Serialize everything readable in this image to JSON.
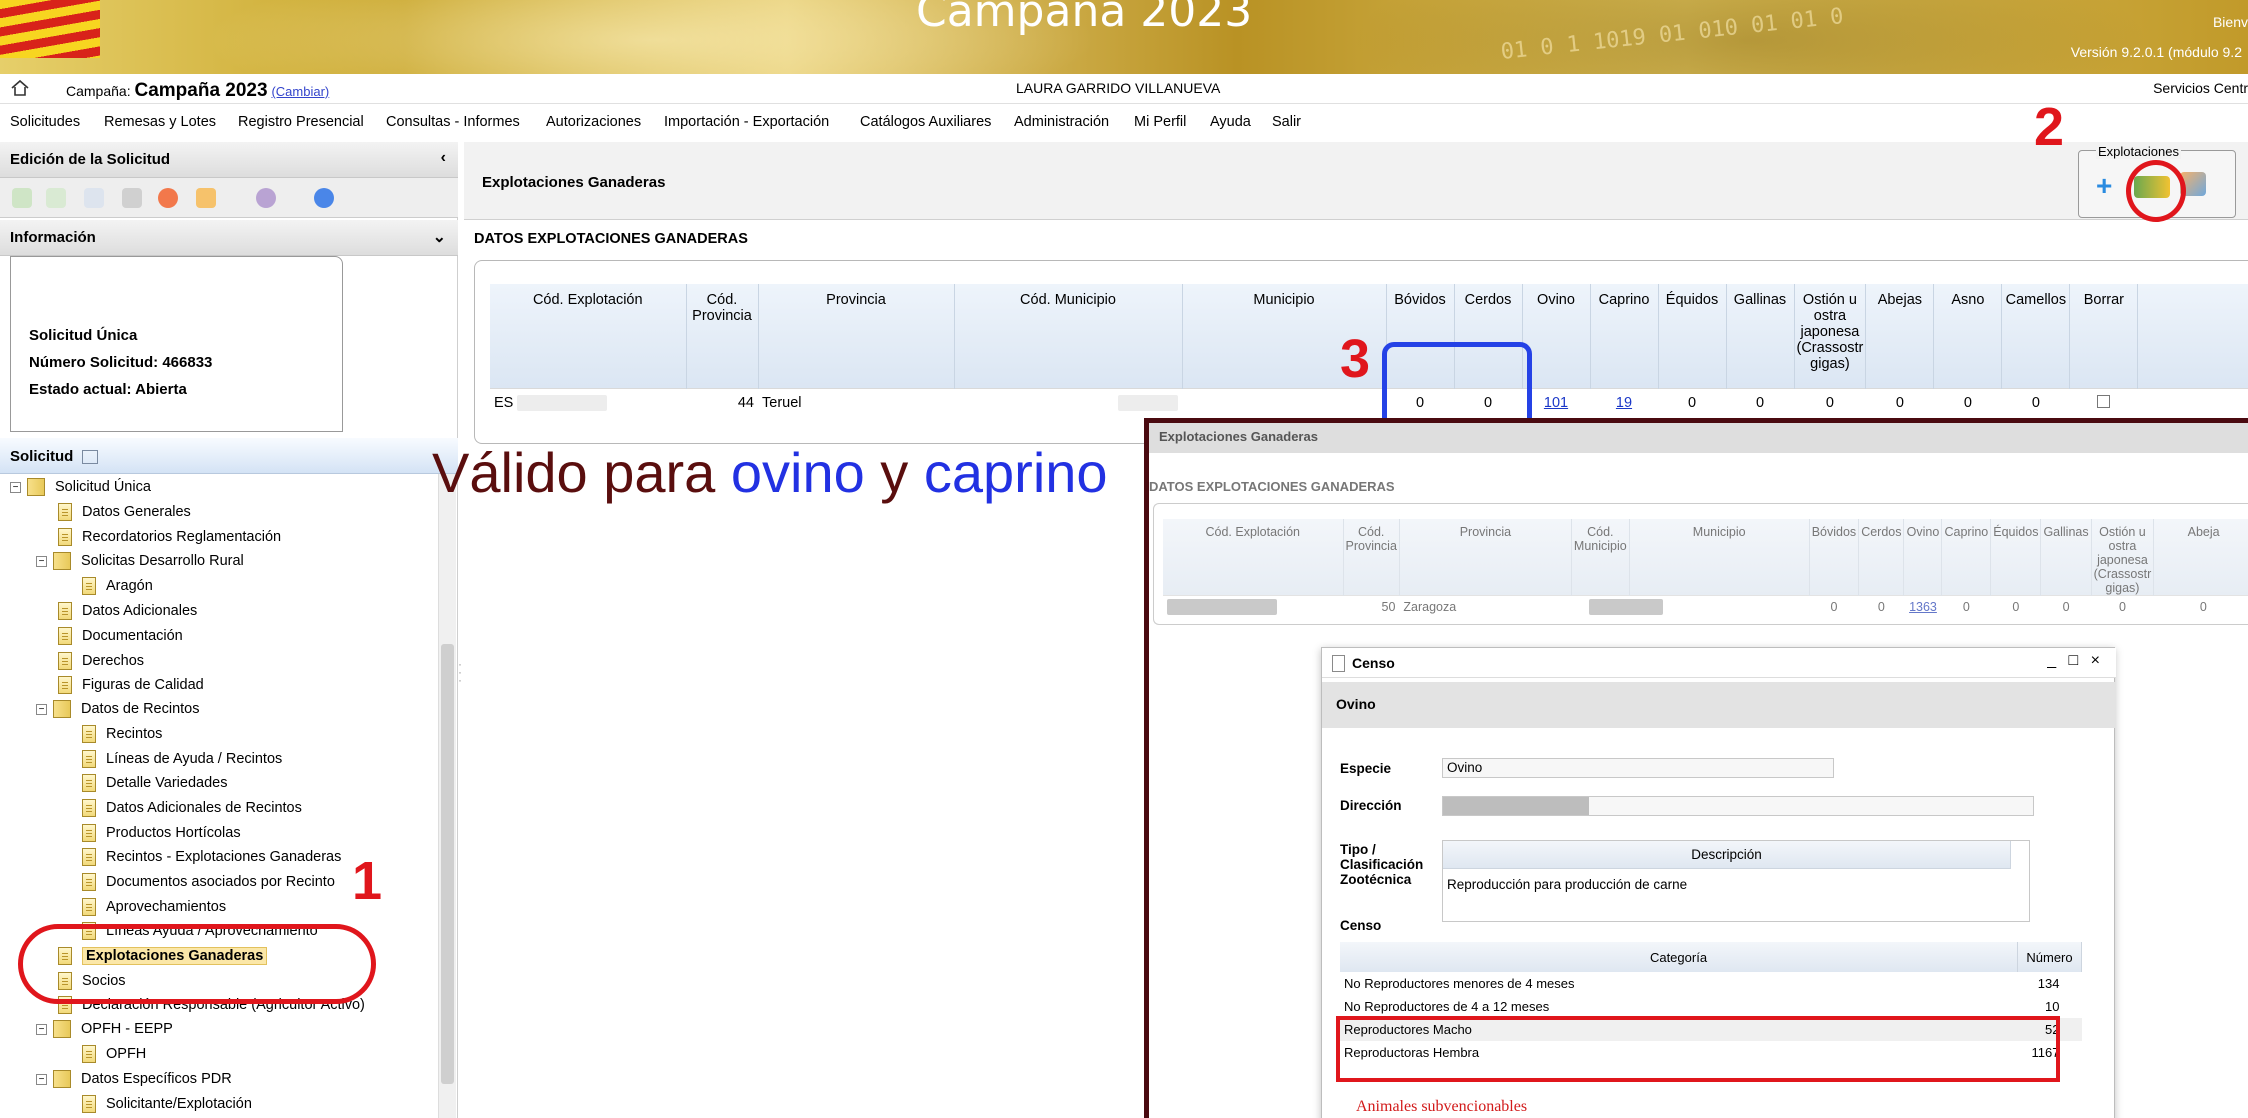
{
  "banner": {
    "title": "Campaña 2023",
    "binary_text": "01  0 1  1019  01  010 01 01 0",
    "welcome": "Bienv",
    "version": "Versión 9.2.0.1 (módulo 9.2"
  },
  "campaign_bar": {
    "label": "Campaña: ",
    "name": "Campaña 2023",
    "change": "(Cambiar)",
    "user": "LAURA GARRIDO VILLANUEVA",
    "services": "Servicios Centr"
  },
  "menu": [
    "Solicitudes",
    "Remesas y Lotes",
    "Registro Presencial",
    "Consultas - Informes",
    "Autorizaciones",
    "Importación - Exportación",
    "Catálogos Auxiliares",
    "Administración",
    "Mi Perfil",
    "Ayuda",
    "Salir"
  ],
  "left_panel": {
    "edicion_title": "Edición de la Solicitud",
    "info_title": "Información",
    "info": {
      "line1": "Solicitud Única",
      "line2": "Número Solicitud: 466833",
      "line3": "Estado actual: Abierta"
    },
    "tree_title": "Solicitud",
    "tree": [
      "Solicitud Única",
      "Datos Generales",
      "Recordatorios Reglamentación",
      "Solicitas Desarrollo Rural",
      "Aragón",
      "Datos Adicionales",
      "Documentación",
      "Derechos",
      "Figuras de Calidad",
      "Datos de Recintos",
      "Recintos",
      "Líneas de Ayuda / Recintos",
      "Detalle Variedades",
      "Datos Adicionales de Recintos",
      "Productos Hortícolas",
      "Recintos - Explotaciones Ganaderas",
      "Documentos asociados por Recinto",
      "Aprovechamientos",
      "Líneas Ayuda / Aprovechamiento",
      "Explotaciones Ganaderas",
      "Socios",
      "Declaración Responsable (Agricultor Activo)",
      "OPFH - EEPP",
      "OPFH",
      "Datos Específicos PDR",
      "Solicitante/Explotación"
    ]
  },
  "main": {
    "title": "Explotaciones Ganaderas",
    "explotaciones_legend": "Explotaciones",
    "add_icon": "+",
    "datos_title": "DATOS EXPLOTACIONES GANADERAS",
    "columns": [
      "Cód. Explotación",
      "Cód. Provincia",
      "Provincia",
      "Cód. Municipio",
      "Municipio",
      "Bóvidos",
      "Cerdos",
      "Ovino",
      "Caprino",
      "Équidos",
      "Gallinas",
      "Ostión u ostra japonesa (Crassostr gigas)",
      "Abejas",
      "Asno",
      "Camellos",
      "Borrar"
    ],
    "row": {
      "cod_explotacion": "ES",
      "cod_provincia": "44",
      "provincia": "Teruel",
      "bovidos": "0",
      "cerdos": "0",
      "ovino": "101",
      "caprino": "19",
      "equidos": "0",
      "gallinas": "0",
      "ostion": "0",
      "abejas": "0",
      "asno": "0",
      "camellos": "0"
    }
  },
  "annotations": {
    "one": "1",
    "two": "2",
    "three": "3",
    "valido_pre": "Válido para ",
    "valido_ovino": "ovino",
    "valido_y": " y ",
    "valido_caprino": "caprino"
  },
  "overlay": {
    "title": "Explotaciones Ganaderas",
    "datos_title": "DATOS EXPLOTACIONES GANADERAS",
    "columns": [
      "Cód. Explotación",
      "Cód. Provincia",
      "Provincia",
      "Cód. Municipio",
      "Municipio",
      "Bóvidos",
      "Cerdos",
      "Ovino",
      "Caprino",
      "Équidos",
      "Gallinas",
      "Ostión u ostra japonesa (Crassostr gigas)",
      "Abeja"
    ],
    "row": {
      "cod_provincia": "50",
      "provincia": "Zaragoza",
      "bovidos": "0",
      "cerdos": "0",
      "ovino": "1363",
      "caprino": "0",
      "equidos": "0",
      "gallinas": "0",
      "ostion": "0",
      "abejas": "0"
    }
  },
  "censo": {
    "title": "Censo",
    "controls": "_ □ ×",
    "section": "Ovino",
    "especie_label": "Especie",
    "especie_value": "Ovino",
    "direccion_label": "Dirección",
    "tipo_label": "Tipo / Clasificación Zootécnica",
    "tipo_header": "Descripción",
    "tipo_value": "Reproducción para producción de carne",
    "censo_label": "Censo",
    "headers": [
      "Categoría",
      "Número"
    ],
    "rows": [
      {
        "cat": "No Reproductores menores de 4 meses",
        "num": "134"
      },
      {
        "cat": "No Reproductores de 4 a 12 meses",
        "num": "10"
      },
      {
        "cat": "Reproductores Macho",
        "num": "52"
      },
      {
        "cat": "Reproductoras Hembra",
        "num": "1167"
      }
    ],
    "footer": "Animales subvencionables"
  },
  "colors": {
    "annotation_red": "#e0161c",
    "annotation_blue": "#2542e6",
    "link": "#1a37c8"
  }
}
